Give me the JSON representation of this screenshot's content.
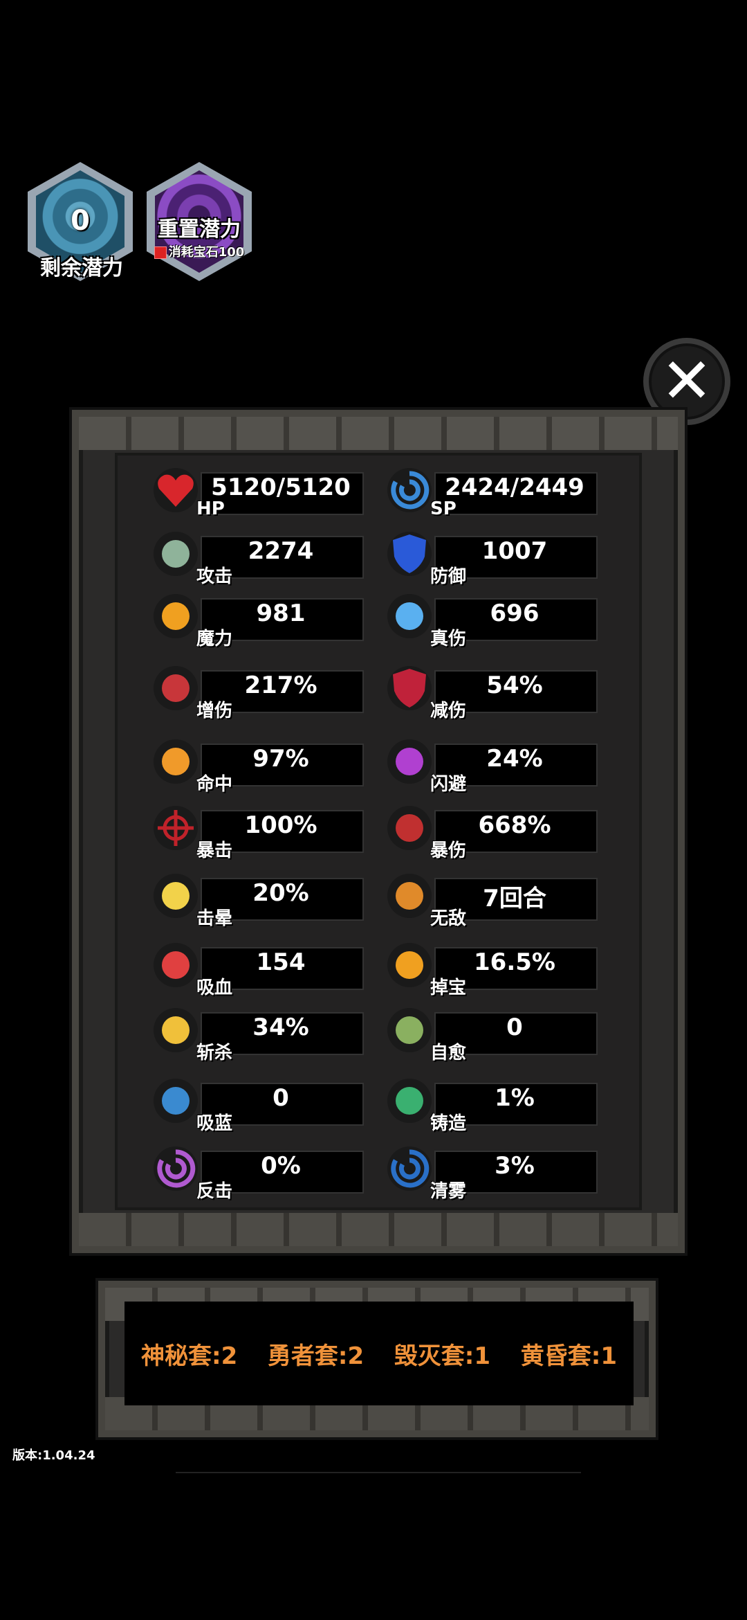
{
  "potential": {
    "value": "0",
    "label": "剩余潜力"
  },
  "reset": {
    "label": "重置潜力",
    "cost": "消耗宝石100"
  },
  "close_label": "✕",
  "stats_left": [
    {
      "icon": "heart-icon",
      "label": "HP",
      "value": "5120/5120"
    },
    {
      "icon": "crossed-swords-icon",
      "label": "攻击",
      "value": "2274"
    },
    {
      "icon": "magic-orb-icon",
      "label": "魔力",
      "value": "981"
    },
    {
      "icon": "fist-icon",
      "label": "增伤",
      "value": "217%"
    },
    {
      "icon": "eye-icon",
      "label": "命中",
      "value": "97%"
    },
    {
      "icon": "crosshair-icon",
      "label": "暴击",
      "value": "100%"
    },
    {
      "icon": "stun-stars-icon",
      "label": "击晕",
      "value": "20%"
    },
    {
      "icon": "blood-vial-icon",
      "label": "吸血",
      "value": "154"
    },
    {
      "icon": "slash-icon",
      "label": "斩杀",
      "value": "34%"
    },
    {
      "icon": "bubbles-icon",
      "label": "吸蓝",
      "value": "0"
    },
    {
      "icon": "crescent-icon",
      "label": "反击",
      "value": "0%"
    }
  ],
  "stats_right": [
    {
      "icon": "vortex-icon",
      "label": "SP",
      "value": "2424/2449"
    },
    {
      "icon": "shield-icon",
      "label": "防御",
      "value": "1007"
    },
    {
      "icon": "ice-claw-icon",
      "label": "真伤",
      "value": "696"
    },
    {
      "icon": "red-shield-icon",
      "label": "减伤",
      "value": "54%"
    },
    {
      "icon": "dodge-runner-icon",
      "label": "闪避",
      "value": "24%"
    },
    {
      "icon": "pickaxe-icon",
      "label": "暴伤",
      "value": "668%"
    },
    {
      "icon": "totem-icon",
      "label": "无敌",
      "value": "7回合"
    },
    {
      "icon": "coin-drop-icon",
      "label": "掉宝",
      "value": "16.5%"
    },
    {
      "icon": "healing-hand-icon",
      "label": "自愈",
      "value": "0"
    },
    {
      "icon": "forge-star-icon",
      "label": "铸造",
      "value": "1%"
    },
    {
      "icon": "mist-orb-icon",
      "label": "清雾",
      "value": "3%"
    }
  ],
  "sets": [
    "神秘套:2",
    "勇者套:2",
    "毁灭套:1",
    "黄昏套:1"
  ],
  "version": "版本:1.04.24",
  "colors": {
    "set_text": "#f0923a",
    "background": "#000000"
  }
}
